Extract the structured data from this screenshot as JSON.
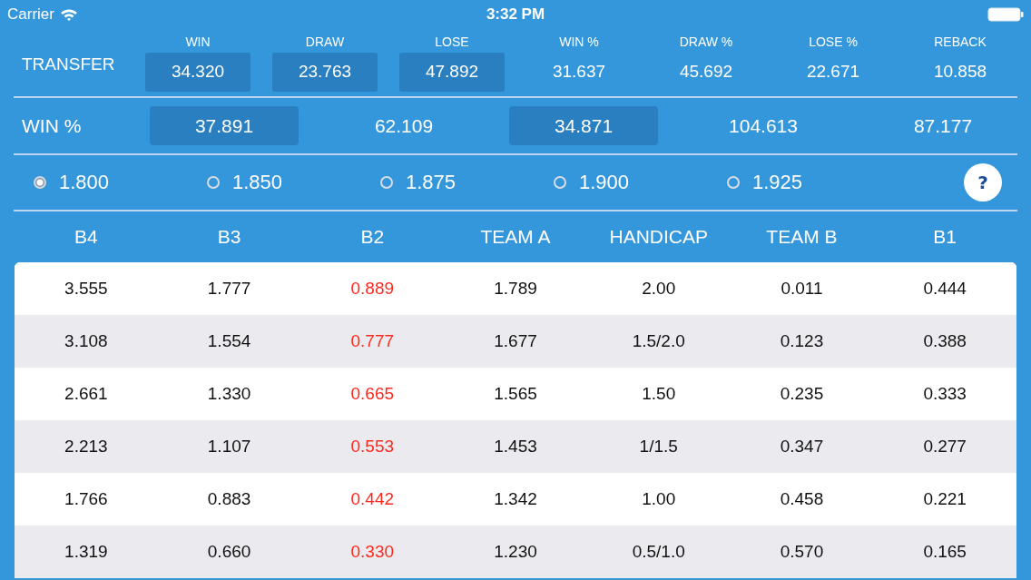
{
  "status_bar": {
    "carrier": "Carrier",
    "time": "3:32 PM"
  },
  "transfer": {
    "label": "TRANSFER",
    "items": [
      {
        "heading": "WIN",
        "value": "34.320",
        "kind": "field"
      },
      {
        "heading": "DRAW",
        "value": "23.763",
        "kind": "field"
      },
      {
        "heading": "LOSE",
        "value": "47.892",
        "kind": "field"
      },
      {
        "heading": "WIN %",
        "value": "31.637",
        "kind": "value"
      },
      {
        "heading": "DRAW %",
        "value": "45.692",
        "kind": "value"
      },
      {
        "heading": "LOSE %",
        "value": "22.671",
        "kind": "value"
      },
      {
        "heading": "REBACK",
        "value": "10.858",
        "kind": "value"
      }
    ]
  },
  "win_pct": {
    "label": "WIN %",
    "items": [
      {
        "value": "37.891",
        "kind": "field"
      },
      {
        "value": "62.109",
        "kind": "value"
      },
      {
        "value": "34.871",
        "kind": "field"
      },
      {
        "value": "104.613",
        "kind": "value"
      },
      {
        "value": "87.177",
        "kind": "value"
      }
    ]
  },
  "odds": [
    {
      "label": "1.800",
      "selected": true
    },
    {
      "label": "1.850",
      "selected": false
    },
    {
      "label": "1.875",
      "selected": false
    },
    {
      "label": "1.900",
      "selected": false
    },
    {
      "label": "1.925",
      "selected": false
    }
  ],
  "help_button": "?",
  "table": {
    "columns": [
      {
        "label": "B4"
      },
      {
        "label": "B3"
      },
      {
        "label": "B2",
        "color": "#ff2a1f"
      },
      {
        "label": "TEAM A"
      },
      {
        "label": "HANDICAP"
      },
      {
        "label": "TEAM B"
      },
      {
        "label": "B1"
      }
    ],
    "rows": [
      [
        "3.555",
        "1.777",
        "0.889",
        "1.789",
        "2.00",
        "0.011",
        "0.444"
      ],
      [
        "3.108",
        "1.554",
        "0.777",
        "1.677",
        "1.5/2.0",
        "0.123",
        "0.388"
      ],
      [
        "2.661",
        "1.330",
        "0.665",
        "1.565",
        "1.50",
        "0.235",
        "0.333"
      ],
      [
        "2.213",
        "1.107",
        "0.553",
        "1.453",
        "1/1.5",
        "0.347",
        "0.277"
      ],
      [
        "1.766",
        "0.883",
        "0.442",
        "1.342",
        "1.00",
        "0.458",
        "0.221"
      ],
      [
        "1.319",
        "0.660",
        "0.330",
        "1.230",
        "0.5/1.0",
        "0.570",
        "0.165"
      ]
    ]
  }
}
